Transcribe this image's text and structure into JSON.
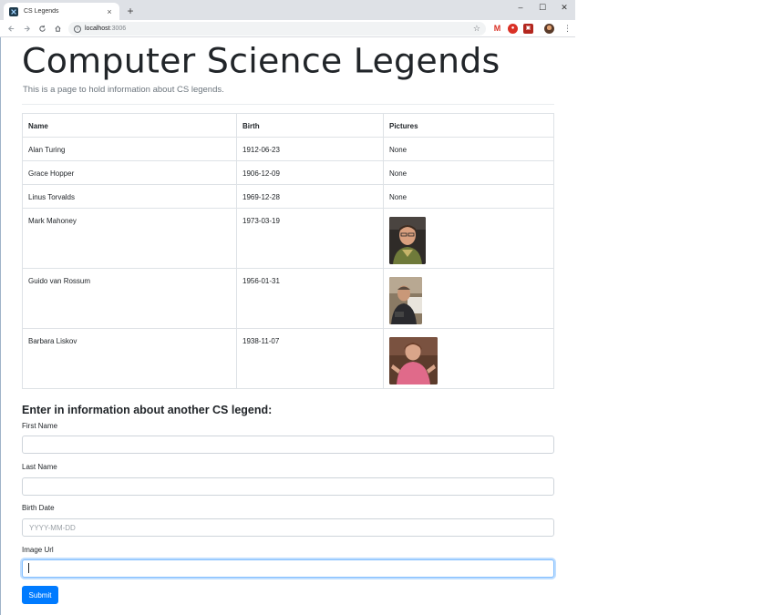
{
  "browser": {
    "tab_title": "CS Legends",
    "tab_close": "×",
    "new_tab": "+",
    "window": {
      "minimize": "–",
      "maximize": "☐",
      "close": "✕"
    },
    "url_host": "localhost",
    "url_port": ":3006",
    "menu": "⋮",
    "star": "☆"
  },
  "page": {
    "title": "Computer Science Legends",
    "lead": "This is a page to hold information about CS legends."
  },
  "table": {
    "headers": [
      "Name",
      "Birth",
      "Pictures"
    ],
    "rows": [
      {
        "name": "Alan Turing",
        "birth": "1912-06-23",
        "picture": "None"
      },
      {
        "name": "Grace Hopper",
        "birth": "1906-12-09",
        "picture": "None"
      },
      {
        "name": "Linus Torvalds",
        "birth": "1969-12-28",
        "picture": "None"
      },
      {
        "name": "Mark Mahoney",
        "birth": "1973-03-19",
        "picture": "photo"
      },
      {
        "name": "Guido van Rossum",
        "birth": "1956-01-31",
        "picture": "photo"
      },
      {
        "name": "Barbara Liskov",
        "birth": "1938-11-07",
        "picture": "photo"
      }
    ]
  },
  "form": {
    "heading": "Enter in information about another CS legend:",
    "first_name_label": "First Name",
    "first_name_value": "",
    "last_name_label": "Last Name",
    "last_name_value": "",
    "birth_label": "Birth Date",
    "birth_placeholder": "YYYY-MM-DD",
    "image_label": "Image Url",
    "image_value": "",
    "submit_label": "Submit"
  },
  "colors": {
    "primary": "#007bff",
    "chrome_bg": "#dee1e6",
    "border": "#dee2e6"
  }
}
